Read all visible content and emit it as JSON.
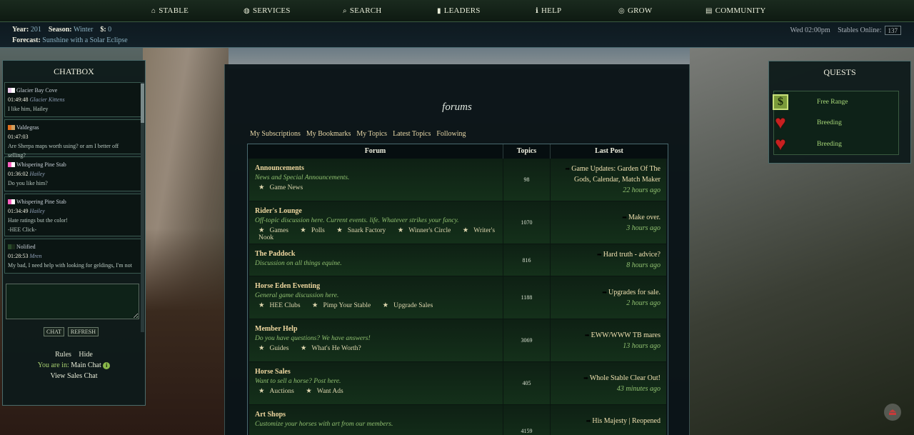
{
  "nav": {
    "items": [
      {
        "label": "STABLE",
        "icon": "home-icon",
        "glyph": "⌂"
      },
      {
        "label": "SERVICES",
        "icon": "globe-icon",
        "glyph": "◍"
      },
      {
        "label": "SEARCH",
        "icon": "search-icon",
        "glyph": "⌕"
      },
      {
        "label": "LEADERS",
        "icon": "bar-chart-icon",
        "glyph": "▮"
      },
      {
        "label": "HELP",
        "icon": "info-icon",
        "glyph": "ℹ"
      },
      {
        "label": "GROW",
        "icon": "target-icon",
        "glyph": "◎"
      },
      {
        "label": "COMMUNITY",
        "icon": "chat-bubble-icon",
        "glyph": "▤"
      }
    ]
  },
  "status": {
    "year_label": "Year:",
    "year": "201",
    "season_label": "Season:",
    "season": "Winter",
    "money_label": "$:",
    "money": "0",
    "forecast_label": "Forecast:",
    "forecast": "Sunshine with a Solar Eclipse",
    "datetime": "Wed 02:00pm",
    "online_label": "Stables Online:",
    "online_count": "137"
  },
  "chatbox": {
    "title": "CHATBOX",
    "messages": [
      {
        "user": "Glacier Bay Cove",
        "flag": [
          "#e8c8e8",
          "#ffffff"
        ],
        "time": "01:49:48",
        "sender": "Glacier Kittens",
        "text": "I like him, Hailey"
      },
      {
        "user": "Valdegras",
        "flag": [
          "#e07020",
          "#d0a060"
        ],
        "time": "01:47:03",
        "sender": "",
        "text": "Are Sherpa maps worth using? or am I better off selling?"
      },
      {
        "user": "Whispering Pine Stab",
        "flag": [
          "#ff60c0",
          "#ffffff"
        ],
        "time": "01:36:02",
        "sender": "Hailey",
        "text": "Do you like him?"
      },
      {
        "user": "Whispering Pine Stab",
        "flag": [
          "#ff60c0",
          "#ffffff"
        ],
        "time": "01:34:49",
        "sender": "Hailey",
        "text": "Hate ratings but the color!",
        "text2": "-HEE Click-"
      },
      {
        "user": "Nolified",
        "flag": [
          "#2a4a2a",
          "#1a2a1a"
        ],
        "time": "01:28:53",
        "sender": "Mren",
        "text": "My bad, I need help with looking for geldings, I'm not"
      }
    ],
    "chat_button": "CHAT",
    "refresh_button": "REFRESH",
    "rules_link": "Rules",
    "hide_link": "Hide",
    "location_label": "You are in:",
    "location": "Main Chat",
    "sales_link": "View Sales Chat"
  },
  "main": {
    "title": "forums",
    "subnav": [
      "My Subscriptions",
      "My Bookmarks",
      "My Topics",
      "Latest Topics",
      "Following"
    ],
    "table": {
      "headers": {
        "forum": "Forum",
        "topics": "Topics",
        "last_post": "Last Post"
      },
      "rows": [
        {
          "name": "Announcements",
          "desc": "News and Special Announcements.",
          "subs": [
            "Game News"
          ],
          "topics": "98",
          "last_title": "Game Updates: Garden Of The Gods, Calendar, Match Maker",
          "last_time": "22 hours ago"
        },
        {
          "name": "Rider's Lounge",
          "desc": "Off-topic discussion here. Current events. life. Whatever strikes your fancy.",
          "subs": [
            "Games",
            "Polls",
            "Snark Factory",
            "Winner's Circle",
            "Writer's Nook"
          ],
          "topics": "1070",
          "last_title": "Make over.",
          "last_time": "3 hours ago"
        },
        {
          "name": "The Paddock",
          "desc": "Discussion on all things equine.",
          "subs": [],
          "topics": "816",
          "last_title": "Hard truth - advice?",
          "last_time": "8 hours ago"
        },
        {
          "name": "Horse Eden Eventing",
          "desc": "General game discussion here.",
          "subs": [
            "HEE Clubs",
            "Pimp Your Stable",
            "Upgrade Sales"
          ],
          "topics": "1188",
          "last_title": "Upgrades for sale.",
          "last_time": "2 hours ago"
        },
        {
          "name": "Member Help",
          "desc": "Do you have questions? We have answers!",
          "subs": [
            "Guides",
            "What's He Worth?"
          ],
          "topics": "3069",
          "last_title": "EWW/WWW TB mares",
          "last_time": "13 hours ago"
        },
        {
          "name": "Horse Sales",
          "desc": "Want to sell a horse? Post here.",
          "subs": [
            "Auctions",
            "Want Ads"
          ],
          "topics": "405",
          "last_title": "Whole Stable Clear Out!",
          "last_time": "43 minutes ago"
        },
        {
          "name": "Art Shops",
          "desc": "Customize your horses with art from our members.",
          "subs": [],
          "topics": "4159",
          "last_title": "His Majesty | Reopened",
          "last_time": ""
        }
      ]
    }
  },
  "quests": {
    "title": "QUESTS",
    "items": [
      {
        "label": "Free Range",
        "icon": "dollar-icon"
      },
      {
        "label": "Breeding",
        "icon": "heart-icon"
      },
      {
        "label": "Breeding",
        "icon": "heart-icon"
      }
    ]
  },
  "colors": {
    "accent_green": "#90c070",
    "forum_title": "#f0d8a0",
    "nav_bg": "#1a2a1e"
  }
}
